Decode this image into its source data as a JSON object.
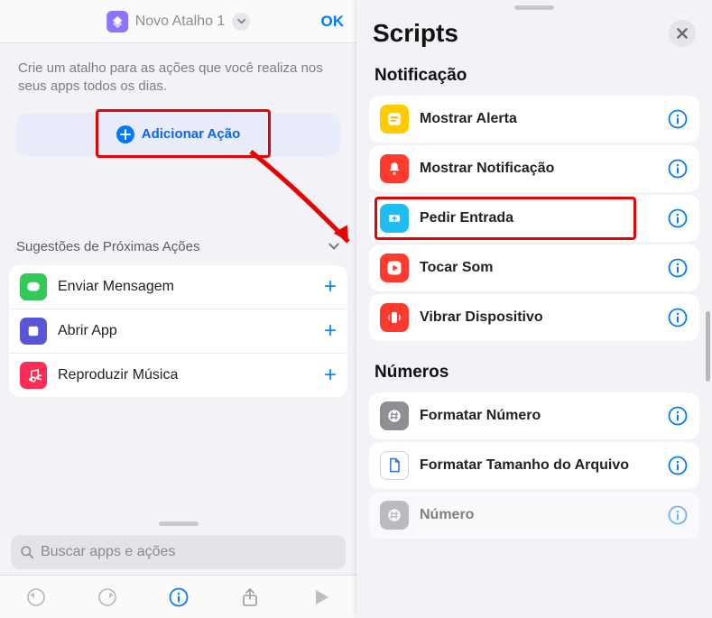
{
  "left": {
    "title": "Novo Atalho 1",
    "ok": "OK",
    "intro": "Crie um atalho para as ações que você realiza nos seus apps todos os dias.",
    "add_action": "Adicionar Ação",
    "suggestions_title": "Sugestões de Próximas Ações",
    "suggestions": [
      {
        "label": "Enviar Mensagem",
        "icon": "message-icon",
        "bg": "#34c759"
      },
      {
        "label": "Abrir App",
        "icon": "app-icon",
        "bg": "#5856d6"
      },
      {
        "label": "Reproduzir Música",
        "icon": "music-icon",
        "bg": "#ff2d55"
      }
    ],
    "search_placeholder": "Buscar apps e ações"
  },
  "right": {
    "title": "Scripts",
    "sections": [
      {
        "title": "Notificação",
        "items": [
          {
            "label": "Mostrar Alerta",
            "icon": "alert-icon",
            "bg": "#ffcc00"
          },
          {
            "label": "Mostrar Notificação",
            "icon": "bell-icon",
            "bg": "#ff3b30"
          },
          {
            "label": "Pedir Entrada",
            "icon": "input-icon",
            "bg": "#20bdf0",
            "highlight": true
          },
          {
            "label": "Tocar Som",
            "icon": "play-icon",
            "bg": "#ff3b30",
            "whiteBody": true
          },
          {
            "label": "Vibrar Dispositivo",
            "icon": "vibrate-icon",
            "bg": "#ff3b30"
          }
        ]
      },
      {
        "title": "Números",
        "items": [
          {
            "label": "Formatar Número",
            "icon": "hash-icon",
            "bg": "#8e8e93"
          },
          {
            "label": "Formatar Tamanho do Arquivo",
            "icon": "file-icon",
            "bg": "#ffffff",
            "fg": "#2f6fd6",
            "border": true
          },
          {
            "label": "Número",
            "icon": "hash-icon",
            "bg": "#8e8e93"
          }
        ]
      }
    ]
  }
}
